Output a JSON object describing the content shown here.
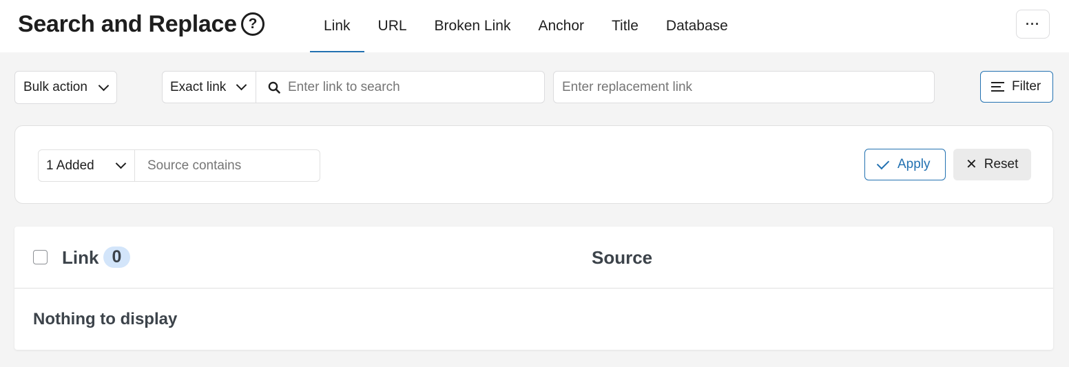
{
  "header": {
    "title": "Search and Replace",
    "help_glyph": "?",
    "more_glyph": "···",
    "tabs": [
      {
        "label": "Link",
        "active": true
      },
      {
        "label": "URL",
        "active": false
      },
      {
        "label": "Broken Link",
        "active": false
      },
      {
        "label": "Anchor",
        "active": false
      },
      {
        "label": "Title",
        "active": false
      },
      {
        "label": "Database",
        "active": false
      }
    ]
  },
  "toolbar": {
    "bulk_action": "Bulk action",
    "match_type": "Exact link",
    "search_placeholder": "Enter link to search",
    "replace_placeholder": "Enter replacement link",
    "filter_label": "Filter"
  },
  "filter_panel": {
    "status_value": "1 Added",
    "source_placeholder": "Source contains",
    "apply_label": "Apply",
    "reset_label": "Reset",
    "reset_glyph": "✕"
  },
  "table": {
    "col_link": "Link",
    "count": "0",
    "col_source": "Source",
    "empty_message": "Nothing to display"
  },
  "colors": {
    "accent": "#2271b1",
    "badge_bg": "#d3e5fa",
    "page_bg": "#f4f4f4"
  },
  "icons": [
    "help-icon",
    "more-icon",
    "chevron-down-icon",
    "search-icon",
    "filter-icon",
    "check-icon",
    "close-icon"
  ]
}
